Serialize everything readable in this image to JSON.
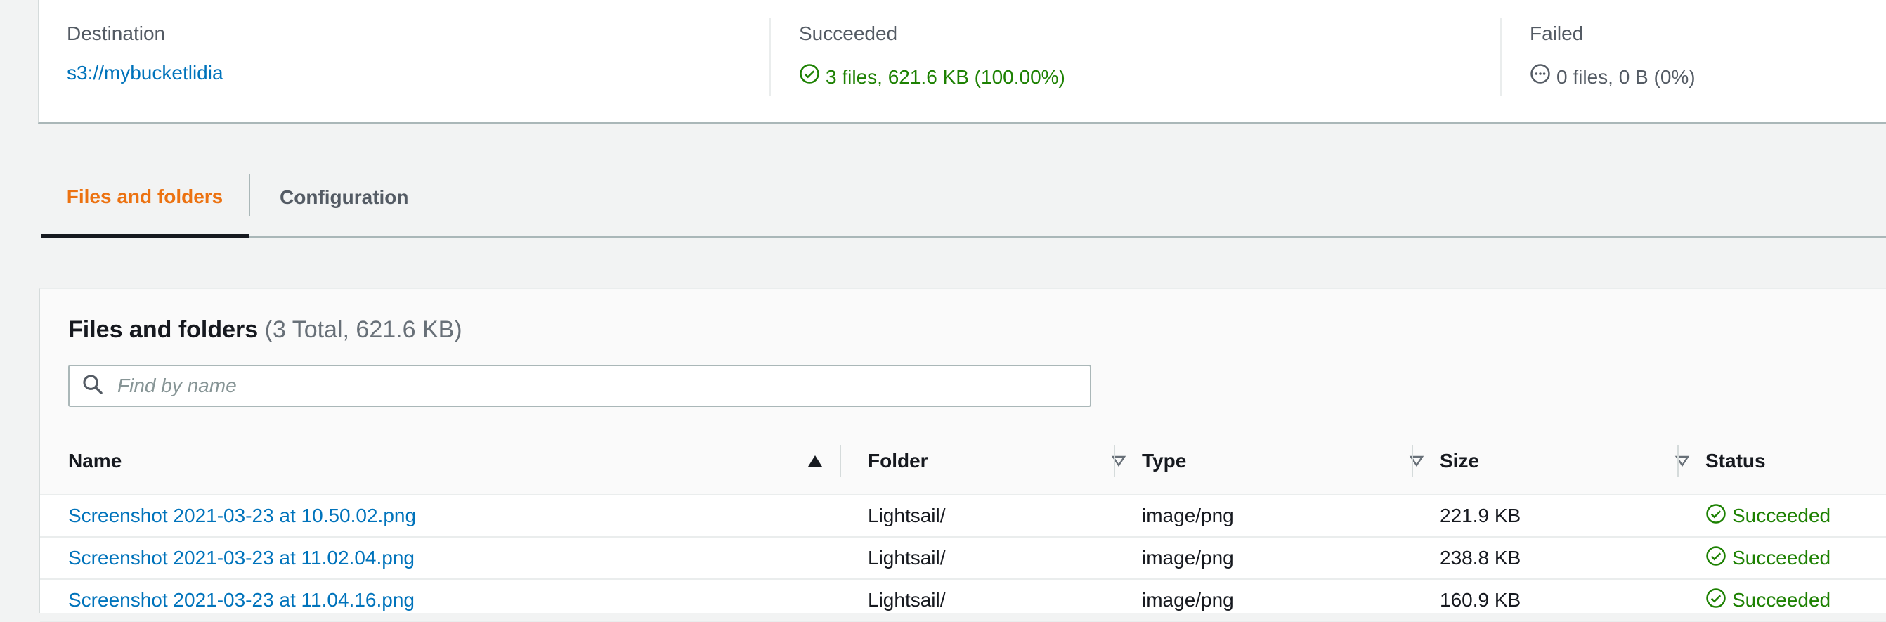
{
  "summary": {
    "destination": {
      "label": "Destination",
      "value": "s3://mybucketlidia"
    },
    "succeeded": {
      "label": "Succeeded",
      "value": "3 files, 621.6 KB (100.00%)",
      "color": "#1d8102"
    },
    "failed": {
      "label": "Failed",
      "value": "0 files, 0 B (0%)"
    }
  },
  "tabs": [
    {
      "label": "Files and folders",
      "active": true
    },
    {
      "label": "Configuration",
      "active": false
    }
  ],
  "files_panel": {
    "title": "Files and folders",
    "count": "(3 Total, 621.6 KB)",
    "search_placeholder": "Find by name",
    "columns": {
      "name": "Name",
      "folder": "Folder",
      "type": "Type",
      "size": "Size",
      "status": "Status"
    },
    "rows": [
      {
        "name": "Screenshot 2021-03-23 at 10.50.02.png",
        "folder": "Lightsail/",
        "type": "image/png",
        "size": "221.9 KB",
        "status": "Succeeded"
      },
      {
        "name": "Screenshot 2021-03-23 at 11.02.04.png",
        "folder": "Lightsail/",
        "type": "image/png",
        "size": "238.8 KB",
        "status": "Succeeded"
      },
      {
        "name": "Screenshot 2021-03-23 at 11.04.16.png",
        "folder": "Lightsail/",
        "type": "image/png",
        "size": "160.9 KB",
        "status": "Succeeded"
      }
    ]
  },
  "colors": {
    "link": "#0073bb",
    "active_tab": "#ec7211",
    "success": "#1d8102"
  }
}
